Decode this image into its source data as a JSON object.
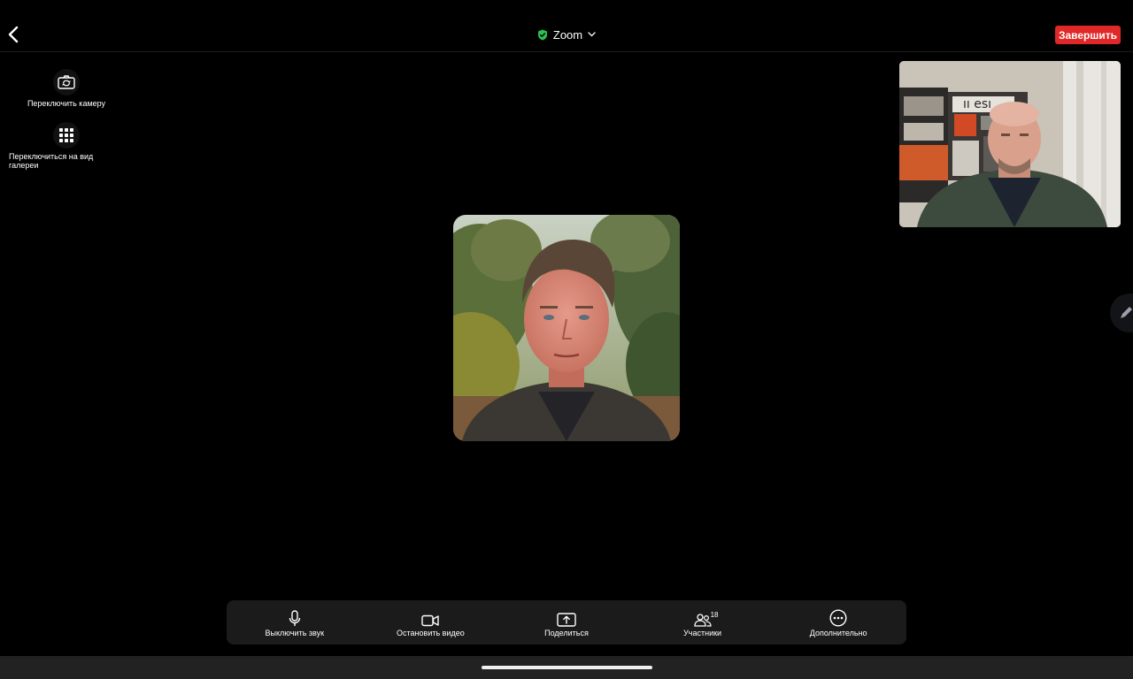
{
  "header": {
    "title": "Zoom",
    "end_label": "Завершить",
    "secure_color": "#2dbe4f",
    "end_color": "#e02828"
  },
  "side": {
    "switch_camera_label": "Переключить камеру",
    "gallery_label": "Переключиться на вид галереи"
  },
  "toolbar": {
    "mute_label": "Выключить звук",
    "stop_video_label": "Остановить видео",
    "share_label": "Поделиться",
    "participants_label": "Участники",
    "participants_count": "18",
    "more_label": "Дополнительно"
  },
  "icons": {
    "back": "chevron-left-icon",
    "secure": "shield-check-icon",
    "dropdown": "chevron-down-icon",
    "camera_switch": "camera-switch-icon",
    "gallery": "grid-icon",
    "mic": "microphone-icon",
    "video": "video-camera-icon",
    "share": "share-screen-icon",
    "participants": "participants-icon",
    "more": "more-icon",
    "pen": "pen-icon"
  }
}
